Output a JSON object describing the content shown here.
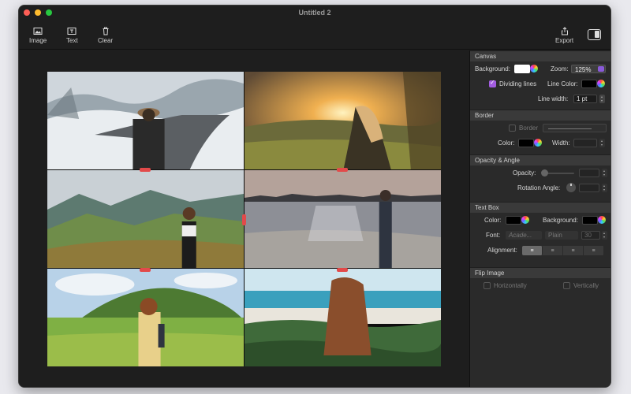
{
  "window": {
    "title": "Untitled 2"
  },
  "toolbar": {
    "image_label": "Image",
    "text_label": "Text",
    "clear_label": "Clear",
    "export_label": "Export"
  },
  "panel": {
    "canvas": {
      "header": "Canvas",
      "background_label": "Background:",
      "background_color": "#ffffff",
      "zoom_label": "Zoom:",
      "zoom_value": "125%",
      "dividing_lines_label": "Dividing lines",
      "dividing_lines_checked": true,
      "line_color_label": "Line Color:",
      "line_color": "#000000",
      "line_width_label": "Line width:",
      "line_width_value": "1 pt"
    },
    "border": {
      "header": "Border",
      "border_label": "Border",
      "color_label": "Color:",
      "color": "#000000",
      "width_label": "Width:"
    },
    "opacity": {
      "header": "Opacity & Angle",
      "opacity_label": "Opacity:",
      "rotation_label": "Rotation Angle:"
    },
    "textbox": {
      "header": "Text Box",
      "color_label": "Color:",
      "color": "#000000",
      "background_label": "Background:",
      "background_color": "#000000",
      "font_label": "Font:",
      "font_value": "Acade...",
      "style_value": "Plain",
      "size_value": "30",
      "alignment_label": "Alignment:",
      "alignment_options": [
        "left",
        "center",
        "right",
        "justify"
      ],
      "alignment_selected": "left"
    },
    "flip": {
      "header": "Flip Image",
      "horizontally_label": "Horizontally",
      "vertically_label": "Vertically"
    }
  },
  "colors": {
    "accent": "#a25ce0",
    "handle": "#e24a4a"
  },
  "grid_photos": [
    {
      "name": "snowy-road-photo"
    },
    {
      "name": "sunset-field-photo"
    },
    {
      "name": "mountain-valley-photo"
    },
    {
      "name": "beach-sunset-photo"
    },
    {
      "name": "green-hill-photo"
    },
    {
      "name": "ocean-beach-photo"
    }
  ]
}
